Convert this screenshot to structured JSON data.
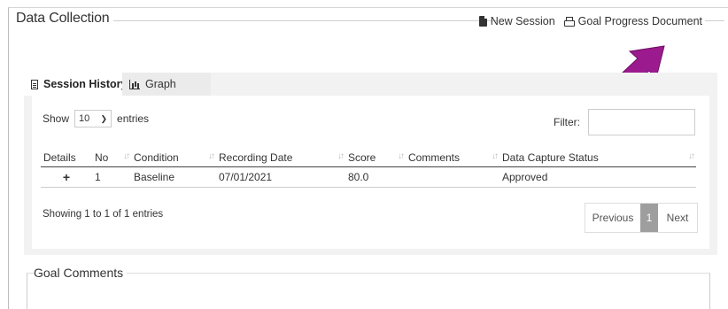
{
  "section": {
    "title": "Data Collection"
  },
  "actions": {
    "new_session": "New Session",
    "goal_progress": "Goal Progress Document"
  },
  "tabs": [
    {
      "label": "Session History",
      "icon": "document-icon",
      "active": true
    },
    {
      "label": "Graph",
      "icon": "bar-chart-icon",
      "active": false
    }
  ],
  "table_controls": {
    "show_label": "Show",
    "entries_label": "entries",
    "page_size": "10",
    "filter_label": "Filter:",
    "filter_value": ""
  },
  "table": {
    "headers": [
      "Details",
      "No",
      "Condition",
      "Recording Date",
      "Score",
      "Comments",
      "Data Capture Status"
    ],
    "rows": [
      {
        "details": "+",
        "no": "1",
        "condition": "Baseline",
        "recording_date": "07/01/2021",
        "score": "80.0",
        "comments": "",
        "status": "Approved"
      }
    ]
  },
  "footer": {
    "info": "Showing 1 to 1 of 1 entries",
    "previous": "Previous",
    "current_page": "1",
    "next": "Next"
  },
  "goal_comments": {
    "title": "Goal Comments"
  },
  "colors": {
    "annotation_arrow": "#9b1b8f",
    "active_page": "#9e9e9e"
  }
}
